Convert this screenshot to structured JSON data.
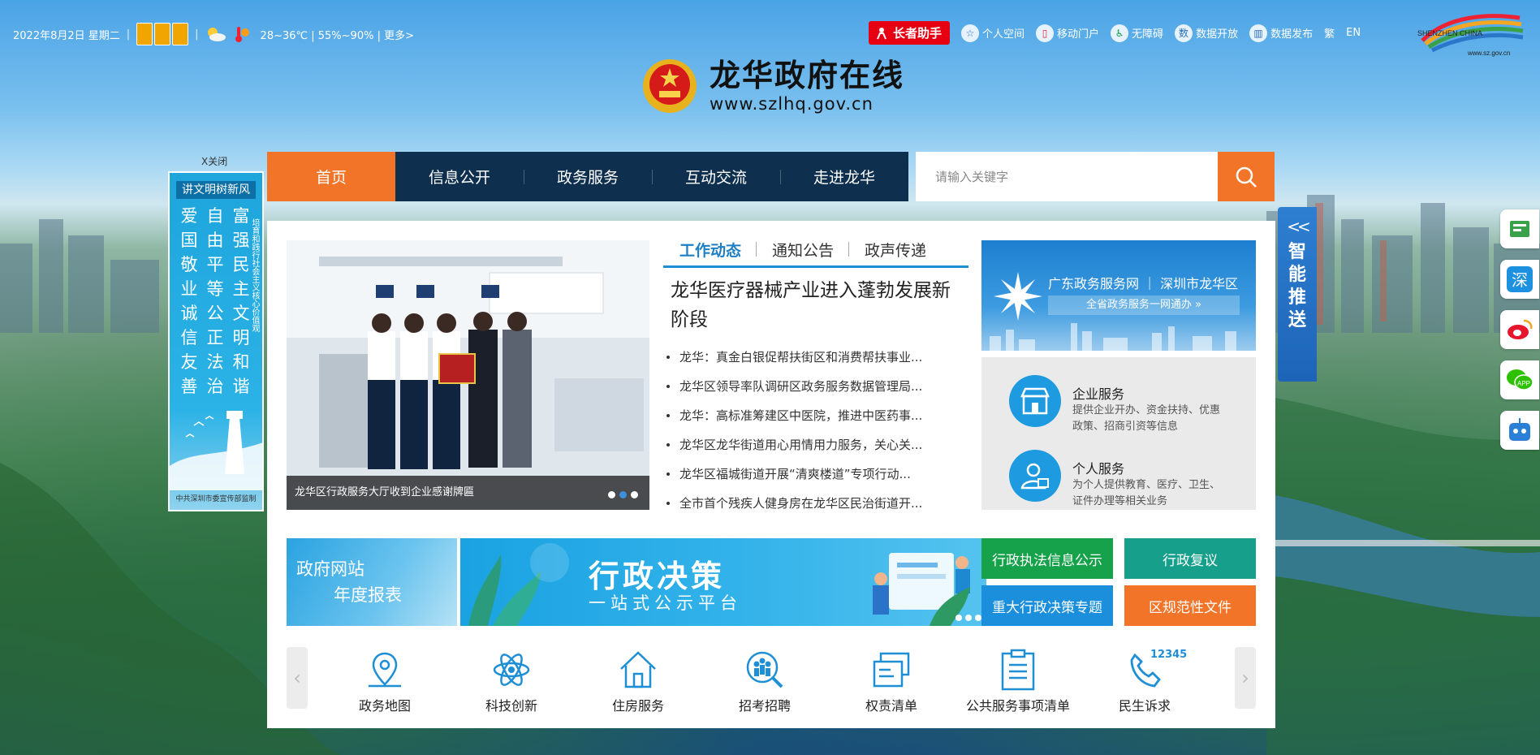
{
  "topbar": {
    "date": "2022年8月2日 星期二",
    "weather": "28~36℃ | 55%~90% | 更多>"
  },
  "toplinks": {
    "elder_label": "长者助手",
    "items": [
      {
        "label": "个人空间",
        "icon": "star-person-icon"
      },
      {
        "label": "移动门户",
        "icon": "mobile-icon"
      },
      {
        "label": "无障碍",
        "icon": "accessibility-icon"
      },
      {
        "label": "数据开放",
        "icon": "data-icon"
      },
      {
        "label": "数据发布",
        "icon": "chart-icon"
      }
    ],
    "trad": "繁",
    "en": "EN"
  },
  "sz_logo": {
    "line1": "SHENZHEN CHINA",
    "line2": "www.sz.gov.cn"
  },
  "site": {
    "title": "龙华政府在线",
    "url": "www.szlhq.gov.cn"
  },
  "nav": [
    {
      "label": "首页",
      "active": true
    },
    {
      "label": "信息公开",
      "active": false
    },
    {
      "label": "政务服务",
      "active": false
    },
    {
      "label": "互动交流",
      "active": false
    },
    {
      "label": "走进龙华",
      "active": false
    }
  ],
  "search": {
    "placeholder": "请输入关键字"
  },
  "left_ad": {
    "close": "X关闭",
    "head": "讲文明树新风",
    "words": [
      "爱",
      "自",
      "富",
      "国",
      "由",
      "强",
      "敬",
      "平",
      "民",
      "业",
      "等",
      "主",
      "诚",
      "公",
      "文",
      "信",
      "正",
      "明",
      "友",
      "法",
      "和",
      "善",
      "治",
      "谐"
    ],
    "side": "培育和践行社会主义核心价值观",
    "foot": "中共深圳市委宣传部监制"
  },
  "smart_push": {
    "chev": "<<",
    "label": "智能推送"
  },
  "slider": {
    "caption": "龙华区行政服务大厅收到企业感谢牌匾"
  },
  "tabs": [
    {
      "label": "工作动态",
      "active": true
    },
    {
      "label": "通知公告",
      "active": false
    },
    {
      "label": "政声传递",
      "active": false
    }
  ],
  "headline": "龙华医疗器械产业进入蓬勃发展新阶段",
  "news": [
    "龙华：真金白银促帮扶街区和消费帮扶事业...",
    "龙华区领导率队调研区政务服务数据管理局...",
    "龙华：高标准筹建区中医院，推进中医药事...",
    "龙华区龙华街道用心用情用力服务，关心关...",
    "龙华区福城街道开展“清爽楼道”专项行动...",
    "全市首个残疾人健身房在龙华区民治街道开..."
  ],
  "gd_banner": {
    "title": "广东政务服务网 ｜ 深圳市龙华区",
    "sub": "全省政务服务一网通办 »"
  },
  "services": [
    {
      "title": "企业服务",
      "desc": "提供企业开办、资金扶持、优惠政策、招商引资等信息"
    },
    {
      "title": "个人服务",
      "desc": "为个人提供教育、医疗、卫生、证件办理等相关业务"
    }
  ],
  "report": {
    "line1": "政府网站",
    "line2": "年度报表"
  },
  "decision": {
    "title": "行政决策",
    "sub": "一站式公示平台"
  },
  "quick": [
    {
      "label": "行政执法信息公示",
      "color": "#16a24a"
    },
    {
      "label": "行政复议",
      "color": "#16a08c"
    },
    {
      "label": "重大行政决策专题",
      "color": "#1c8fdc"
    },
    {
      "label": "区规范性文件",
      "color": "#f27428"
    }
  ],
  "icons": [
    {
      "label": "政务地图",
      "icon": "map-pin-icon"
    },
    {
      "label": "科技创新",
      "icon": "atom-icon"
    },
    {
      "label": "住房服务",
      "icon": "house-icon"
    },
    {
      "label": "招考招聘",
      "icon": "people-search-icon"
    },
    {
      "label": "权责清单",
      "icon": "folder-icon"
    },
    {
      "label": "公共服务事项清单",
      "icon": "clipboard-icon"
    },
    {
      "label": "民生诉求",
      "icon": "phone-icon",
      "badge": "12345"
    }
  ],
  "colors": {
    "accent": "#f27428",
    "nav": "#0e2f4e",
    "blue": "#1e8fd5"
  }
}
